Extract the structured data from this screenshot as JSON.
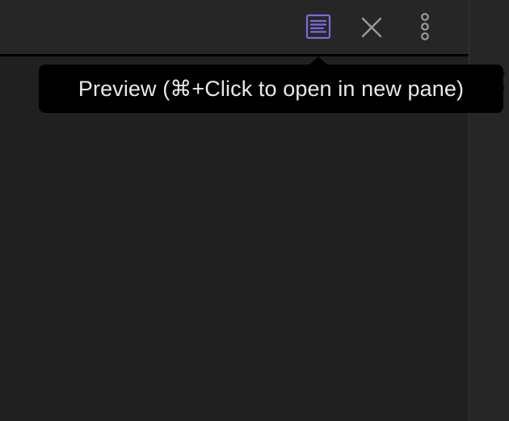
{
  "toolbar": {
    "preview_icon": "document-lines-icon",
    "close_icon": "close-icon",
    "more_icon": "more-options-icon"
  },
  "tooltip": {
    "text": "Preview (⌘+Click to open in new pane)"
  },
  "colors": {
    "accent": "#7b6cd9",
    "icon_gray": "#9a9a9a",
    "tooltip_bg": "#000000",
    "tooltip_text": "#e8e8e8"
  }
}
